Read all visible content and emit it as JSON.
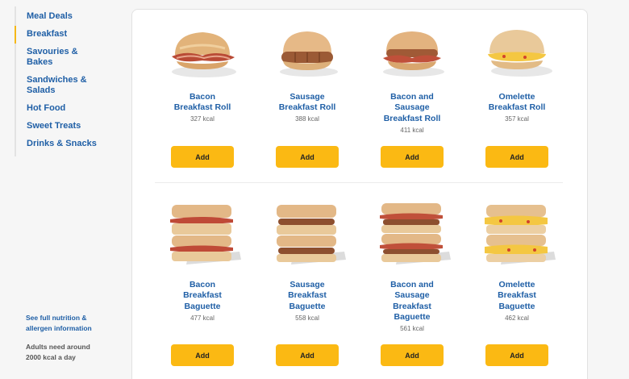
{
  "sidebar": {
    "items": [
      {
        "label": "Meal Deals",
        "active": false
      },
      {
        "label": "Breakfast",
        "active": true
      },
      {
        "label": "Savouries &\nBakes",
        "active": false
      },
      {
        "label": "Sandwiches &\nSalads",
        "active": false
      },
      {
        "label": "Hot Food",
        "active": false
      },
      {
        "label": "Sweet Treats",
        "active": false
      },
      {
        "label": "Drinks & Snacks",
        "active": false
      }
    ],
    "nutrition_link": "See full nutrition &\nallergen information",
    "note": "Adults need around\n2000 kcal a day"
  },
  "colors": {
    "accent": "#fbb913",
    "link": "#1f5fa6",
    "active_marker": "#f5b819"
  },
  "products": [
    {
      "name": "Bacon\nBreakfast Roll",
      "kcal": "327 kcal",
      "button": "Add",
      "icon": "bacon-roll-image"
    },
    {
      "name": "Sausage\nBreakfast Roll",
      "kcal": "388 kcal",
      "button": "Add",
      "icon": "sausage-roll-image"
    },
    {
      "name": "Bacon and\nSausage\nBreakfast Roll",
      "kcal": "411 kcal",
      "button": "Add",
      "icon": "bacon-sausage-roll-image"
    },
    {
      "name": "Omelette\nBreakfast Roll",
      "kcal": "357 kcal",
      "button": "Add",
      "icon": "omelette-roll-image"
    },
    {
      "name": "Bacon\nBreakfast\nBaguette",
      "kcal": "477 kcal",
      "button": "Add",
      "icon": "bacon-baguette-image"
    },
    {
      "name": "Sausage\nBreakfast\nBaguette",
      "kcal": "558 kcal",
      "button": "Add",
      "icon": "sausage-baguette-image"
    },
    {
      "name": "Bacon and\nSausage\nBreakfast\nBaguette",
      "kcal": "561 kcal",
      "button": "Add",
      "icon": "bacon-sausage-baguette-image"
    },
    {
      "name": "Omelette\nBreakfast\nBaguette",
      "kcal": "462 kcal",
      "button": "Add",
      "icon": "omelette-baguette-image"
    }
  ]
}
